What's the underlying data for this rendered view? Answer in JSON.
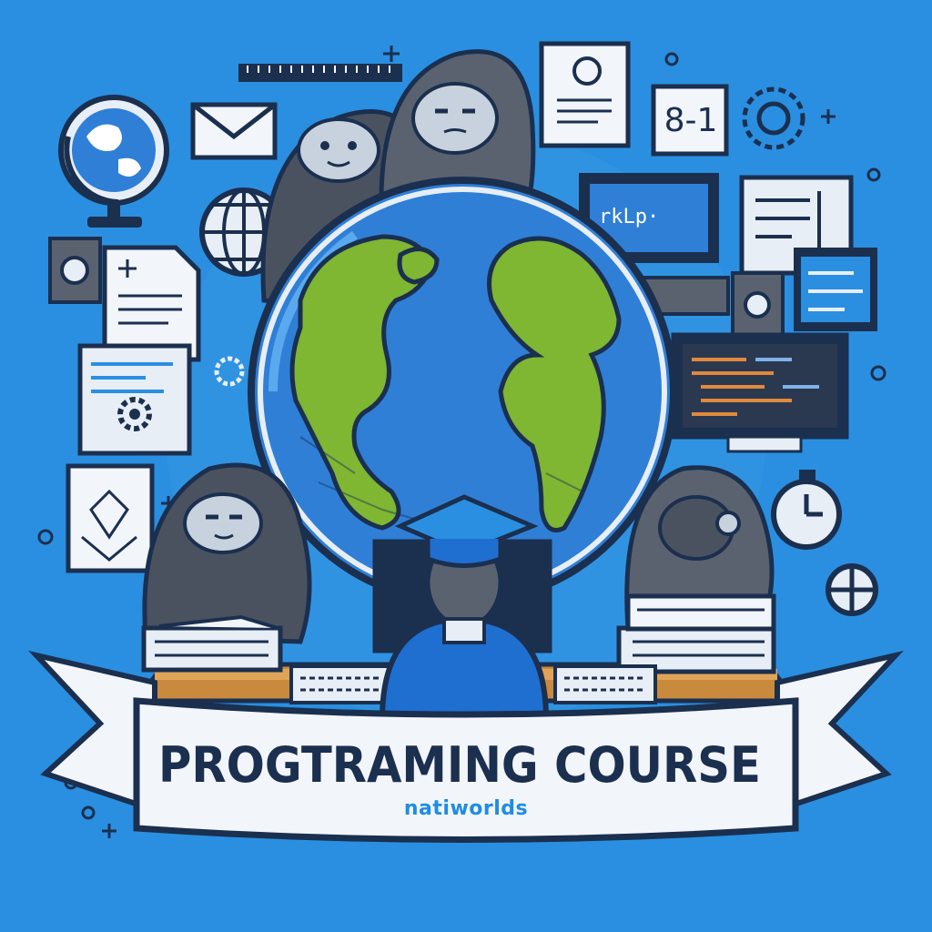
{
  "banner": {
    "title": "PROGTRAMING COURSE",
    "subtitle": "natiworlds"
  },
  "monitor_top": {
    "screen_text": "rkLp·"
  },
  "tile": {
    "text": "8-1"
  },
  "palette": {
    "background": "#2a8fe0",
    "outline": "#1b2f4f",
    "globe_ocean": "#2f7fd6",
    "land": "#7fb632",
    "hood": "#5a6270",
    "paper": "#e8eef6",
    "banner": "#f2f5fa",
    "accent_blue": "#1f8de3"
  },
  "icons": [
    "globe-icon",
    "envelope-icon",
    "document-icon",
    "settings-icon",
    "clock-icon",
    "crosshair-icon",
    "keyboard-icon",
    "graduation-cap-icon",
    "books-icon",
    "code-monitor-icon"
  ]
}
